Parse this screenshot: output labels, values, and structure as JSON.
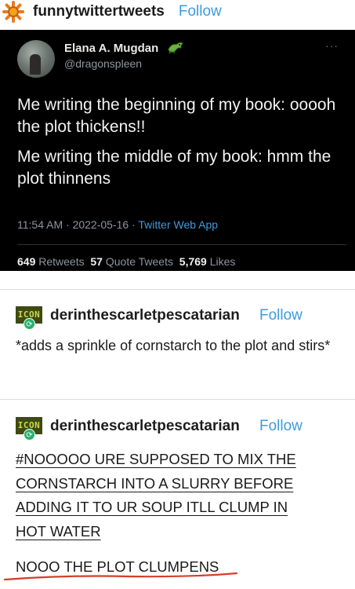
{
  "header": {
    "username": "funnytwittertweets",
    "follow_label": "Follow",
    "avatar_icon": "sunflower-icon"
  },
  "tweet": {
    "name": "Elana A. Mugdan",
    "handle": "@dragonspleen",
    "more_label": "···",
    "body": [
      "Me writing the beginning of my book: ooooh the plot thickens!!",
      "Me writing the middle of my book: hmm the plot thinnens"
    ],
    "meta": {
      "time": "11:54 AM",
      "date": "2022-05-16",
      "separator": "·",
      "app": "Twitter Web App"
    },
    "stats": {
      "retweets": "649",
      "retweets_label": "Retweets",
      "quote_tweets": "57",
      "quote_tweets_label": "Quote Tweets",
      "likes": "5,769",
      "likes_label": "Likes"
    }
  },
  "posts": [
    {
      "icon_text": "ICON",
      "username": "derinthescarletpescatarian",
      "follow_label": "Follow",
      "text": "*adds a sprinkle of cornstarch to the plot and stirs*"
    },
    {
      "icon_text": "ICON",
      "username": "derinthescarletpescatarian",
      "follow_label": "Follow",
      "tag_lines": [
        "#NOOOOO URE SUPPOSED TO MIX THE",
        "CORNSTARCH INTO A SLURRY BEFORE",
        "ADDING IT TO UR SOUP ITLL CLUMP IN",
        "HOT WATER"
      ],
      "final_line": "NOOO THE PLOT CLUMPENS"
    }
  ],
  "colors": {
    "follow": "#3d9be0",
    "tweet_bg": "#000000",
    "reblog_green": "#23b36c",
    "annotation_red": "#d2402a"
  }
}
